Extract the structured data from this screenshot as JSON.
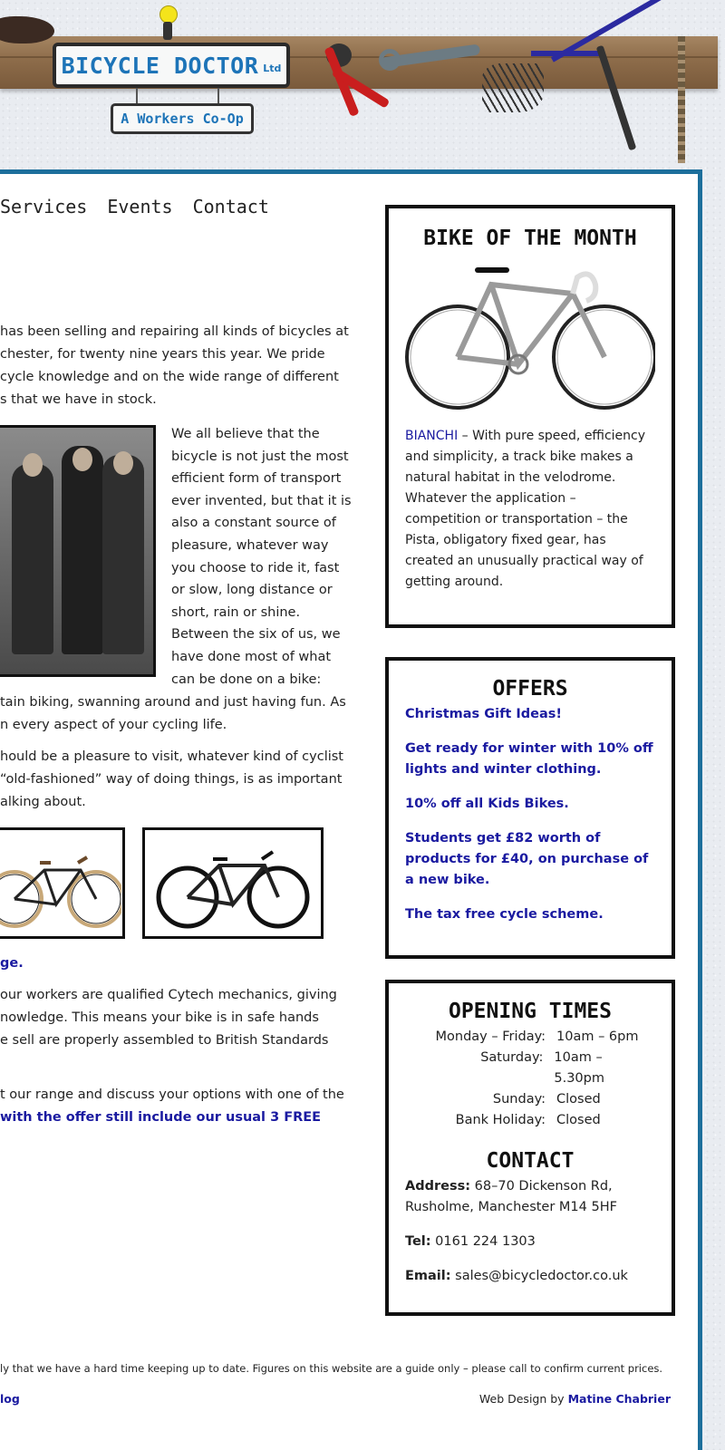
{
  "header": {
    "sign_title": "BICYCLE DOCTOR",
    "sign_ltd": "Ltd",
    "sign_subtitle": "A Workers Co-Op"
  },
  "nav": {
    "items": [
      "Services",
      "Events",
      "Contact"
    ]
  },
  "intro": {
    "lines": [
      "has been selling and repairing all kinds of bicycles at",
      "chester, for twenty nine years this year. We pride",
      "cycle knowledge and on the wide range of different",
      "s that we have in stock."
    ]
  },
  "photo_text": {
    "lines": [
      "We all believe that the",
      "bicycle is not just the most",
      "efficient form of transport",
      "ever invented, but that it is",
      "also a constant source of",
      "pleasure, whatever way",
      "you choose to ride it, fast",
      "or slow, long distance or",
      "short, rain or shine.",
      "Between the six of us, we",
      "have done most of what",
      "can be done on a bike:"
    ],
    "continued": [
      "tain biking, swanning around and just having fun. As",
      "n every aspect of your cycling life."
    ]
  },
  "pleasure_para": {
    "lines": [
      "hould be a pleasure to visit, whatever kind of cyclist",
      "“old-fashioned” way of doing things, is as important",
      "alking about."
    ]
  },
  "range_link": "ge.",
  "cytech_para": {
    "lines": [
      "our workers are qualified Cytech mechanics, giving",
      "nowledge. This means your bike is in safe hands",
      "e sell are properly assembled to British Standards"
    ]
  },
  "range_para": {
    "line1": "t our range and discuss your options with one of the",
    "line2": "with the offer still include our usual 3 FREE"
  },
  "footer": {
    "note": "ly that we have a hard time keeping up to date. Figures on this website are a guide only – please call to confirm current prices.",
    "left_link": "log",
    "credit_prefix": "Web Design by",
    "credit_name": "Matine Chabrier"
  },
  "bike_of_month": {
    "title": "BIKE OF THE MONTH",
    "brand": "BIANCHI",
    "description": " – With pure speed, efficiency and simplicity, a track bike makes a natural habitat in the velodrome. Whatever the application – competition or transportation – the Pista, obligatory fixed gear, has created an unusually practical way of getting around."
  },
  "offers": {
    "title": "OFFERS",
    "items": [
      "Christmas Gift Ideas!",
      "Get ready for winter with 10% off lights and winter clothing.",
      "10% off all Kids Bikes.",
      "Students get £82 worth of products for £40, on purchase of a new bike.",
      "The tax free cycle scheme."
    ]
  },
  "opening_times": {
    "title": "OPENING TIMES",
    "rows": [
      {
        "day": "Monday – Friday:",
        "hours": "10am – 6pm"
      },
      {
        "day": "Saturday:",
        "hours": "10am – 5.30pm"
      },
      {
        "day": "Sunday:",
        "hours": "Closed"
      },
      {
        "day": "Bank Holiday:",
        "hours": "Closed"
      }
    ]
  },
  "contact": {
    "title": "CONTACT",
    "address_label": "Address:",
    "address_value": " 68–70 Dickenson Rd,",
    "address_line2": "Rusholme, Manchester M14 5HF",
    "tel_label": "Tel:",
    "tel_value": " 0161 224 1303",
    "email_label": "Email:",
    "email_value": " sales@bicycledoctor.co.uk"
  },
  "colors": {
    "accent_blue": "#1d6f9c",
    "link_blue": "#1a1aa0",
    "sign_blue": "#1d74b8"
  }
}
